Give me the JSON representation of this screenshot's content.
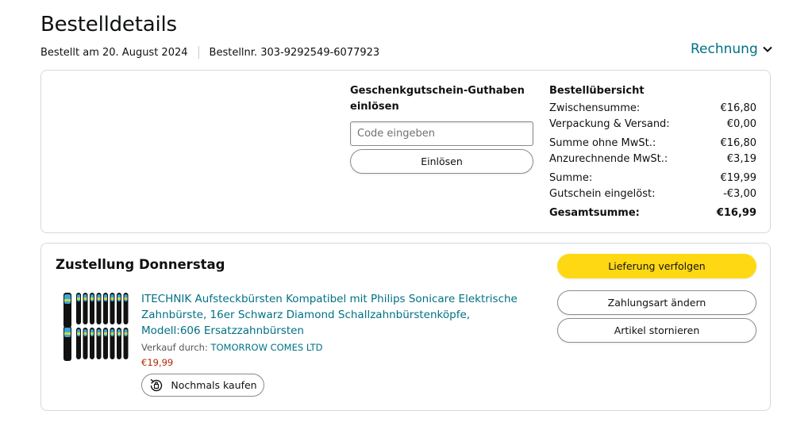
{
  "header": {
    "title": "Bestelldetails",
    "order_date": "Bestellt am 20. August 2024",
    "order_number": "Bestellnr. 303-9292549-6077923",
    "invoice_label": "Rechnung"
  },
  "gift_card": {
    "title": "Geschenkgutschein-Guthaben einlösen",
    "placeholder": "Code eingeben",
    "redeem_label": "Einlösen"
  },
  "order_summary": {
    "title": "Bestellübersicht",
    "rows": [
      {
        "label": "Zwischensumme:",
        "value": "€16,80"
      },
      {
        "label": "Verpackung & Versand:",
        "value": "€0,00"
      },
      {
        "label": "Summe ohne MwSt.:",
        "value": "€16,80"
      },
      {
        "label": "Anzurechnende MwSt.:",
        "value": "€3,19"
      },
      {
        "label": "Summe:",
        "value": "€19,99"
      },
      {
        "label": "Gutschein eingelöst:",
        "value": "-€3,00"
      }
    ],
    "total": {
      "label": "Gesamtsumme:",
      "value": "€16,99"
    }
  },
  "delivery": {
    "title": "Zustellung Donnerstag",
    "product": {
      "title": "ITECHNIK Aufsteckbürsten Kompatibel mit Philips Sonicare Elektrische Zahnbürste, 16er Schwarz Diamond Schallzahnbürstenköpfe, Modell:606 Ersatzzahnbürsten",
      "seller_prefix": "Verkauf durch:",
      "seller_name": "TOMORROW COMES LTD",
      "price": "€19,99",
      "buy_again_label": "Nochmals kaufen"
    },
    "actions": {
      "track_label": "Lieferung verfolgen",
      "change_payment_label": "Zahlungsart ändern",
      "cancel_label": "Artikel stornieren"
    }
  },
  "colors": {
    "link": "#007185",
    "price": "#b12704",
    "primary_button": "#ffd814",
    "border": "#d5d9d9"
  }
}
